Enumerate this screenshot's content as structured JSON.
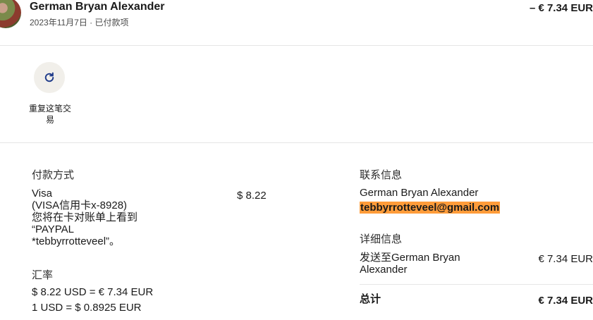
{
  "header": {
    "name": "German Bryan Alexander",
    "date_status": "2023年11月7日 · 已付款项",
    "amount": "– € 7.34 EUR"
  },
  "actions": {
    "repeat_label_line1": "重复这笔交",
    "repeat_label_line2": "易",
    "repeat_icon": "refresh-icon"
  },
  "payment": {
    "heading": "付款方式",
    "card_lines": [
      "Visa",
      "(VISA信用卡x-8928)",
      "您将在卡对账单上看到",
      "“PAYPAL",
      "*tebbyrrotteveel”。"
    ],
    "card_amount": "$ 8.22"
  },
  "exchange": {
    "heading": "汇率",
    "line1": "$ 8.22 USD = € 7.34 EUR",
    "line2": "1 USD = $ 0.8925 EUR"
  },
  "contact": {
    "heading": "联系信息",
    "name": "German Bryan Alexander",
    "email": "tebbyrrotteveel@gmail.com"
  },
  "details": {
    "heading": "详细信息",
    "sent_to_line1": "发送至German Bryan",
    "sent_to_line2": "Alexander",
    "sent_amount": "€ 7.34 EUR",
    "total_label": "总计",
    "total_amount": "€ 7.34 EUR"
  },
  "colors": {
    "highlight": "#ff9c3a",
    "icon_bg": "#f1efea",
    "divider": "#e6e6e6"
  }
}
